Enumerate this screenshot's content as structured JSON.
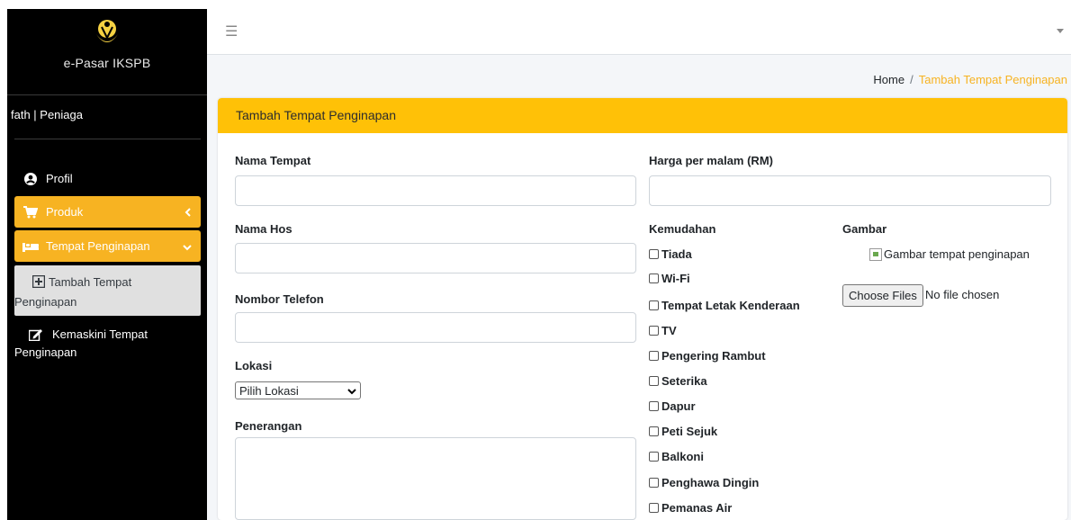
{
  "sidebar": {
    "brand": "e-Pasar IKSPB",
    "user": "fath | Peniaga",
    "items": [
      {
        "label": "Profil",
        "icon": "user-circle-icon"
      },
      {
        "label": "Produk",
        "icon": "cart-icon"
      },
      {
        "label": "Tempat Penginapan",
        "icon": "bed-icon"
      }
    ],
    "submenu": {
      "add_label": "Tambah Tempat Penginapan",
      "edit_label": "Kemaskini Tempat Penginapan"
    }
  },
  "topbar": {
    "menu_icon": "hamburger-icon"
  },
  "breadcrumb": {
    "home": "Home",
    "separator": "/",
    "current": "Tambah Tempat Penginapan"
  },
  "form": {
    "header": "Tambah Tempat Penginapan",
    "nama_tempat_label": "Nama Tempat",
    "harga_label": "Harga per malam (RM)",
    "nama_hos_label": "Nama Hos",
    "telefon_label": "Nombor Telefon",
    "lokasi_label": "Lokasi",
    "lokasi_selected": "Pilih Lokasi",
    "penerangan_label": "Penerangan",
    "kemudahan_label": "Kemudahan",
    "kemudahan": [
      "Tiada",
      "Wi-Fi",
      "Tempat Letak Kenderaan",
      "TV",
      "Pengering Rambut",
      "Seterika",
      "Dapur",
      "Peti Sejuk",
      "Balkoni",
      "Penghawa Dingin",
      "Pemanas Air"
    ],
    "gambar_label": "Gambar",
    "gambar_alt": "Gambar tempat penginapan",
    "choose_files": "Choose Files",
    "no_file": "No file chosen"
  },
  "colors": {
    "accent": "#f7b322",
    "header": "#ffc107",
    "sidebar": "#000000"
  }
}
